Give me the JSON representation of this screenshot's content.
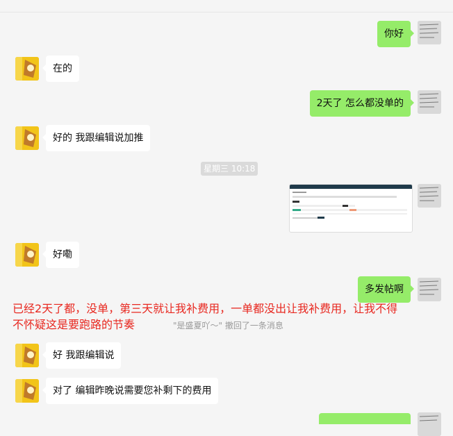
{
  "chat": {
    "messages": [
      {
        "side": "right",
        "text": "你好"
      },
      {
        "side": "left",
        "text": "在的"
      },
      {
        "side": "right",
        "text": "2天了  怎么都没单的"
      },
      {
        "side": "left",
        "text": "好的 我跟编辑说加推"
      },
      {
        "side": "right",
        "type": "image"
      },
      {
        "side": "left",
        "text": "好嘞"
      },
      {
        "side": "right",
        "text": "多发帖啊"
      },
      {
        "side": "left",
        "text": "好 我跟编辑说"
      },
      {
        "side": "left",
        "text": "对了 编辑昨晚说需要您补剩下的费用"
      }
    ],
    "timestamp": "星期三 10:18",
    "annotation": "已经2天了都，没单，第三天就让我补费用，一单都没出让我补费用，让我不得不怀疑这是要跑路的节奏",
    "recall_notice": "\"是盛夏吖～\" 撤回了一条消息"
  },
  "colors": {
    "sent_bubble": "#95ec69",
    "received_bubble": "#ffffff",
    "annotation": "#e8271f"
  },
  "icons": {
    "left_avatar": "cartoon-avatar-icon",
    "right_avatar": "user-avatar-icon"
  }
}
